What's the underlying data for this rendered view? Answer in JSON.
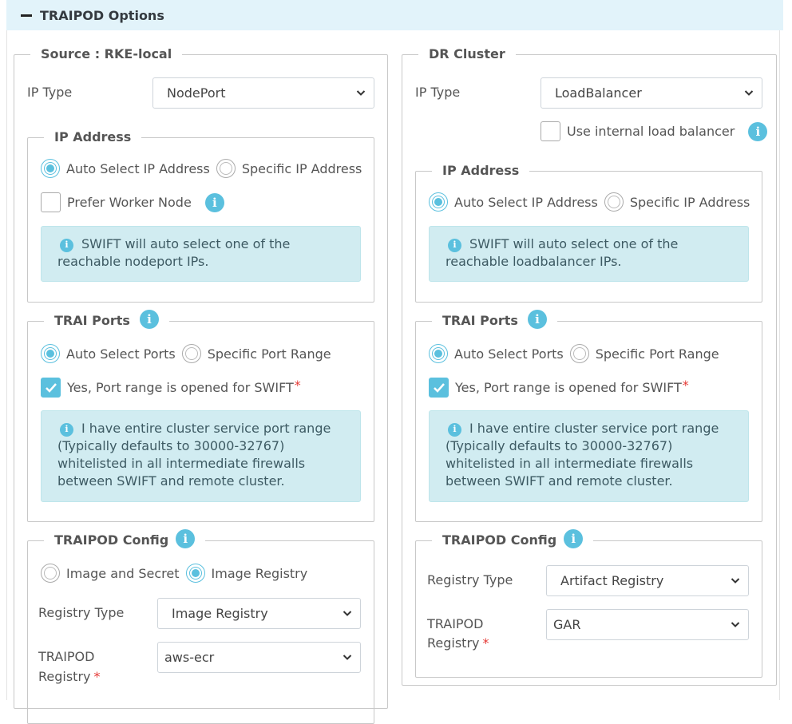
{
  "header": {
    "title": "TRAIPOD Options"
  },
  "source": {
    "legend": "Source : RKE-local",
    "ip_type_label": "IP Type",
    "ip_type_value": "NodePort",
    "ip_address": {
      "legend": "IP Address",
      "radio_auto": "Auto Select IP Address",
      "radio_specific": "Specific IP Address",
      "selected": "auto",
      "prefer_worker_label": "Prefer Worker Node",
      "prefer_worker_checked": false,
      "alert": "SWIFT will auto select one of the reachable nodeport IPs."
    },
    "trai_ports": {
      "legend": "TRAI Ports",
      "radio_auto": "Auto Select Ports",
      "radio_specific": "Specific Port Range",
      "selected": "auto",
      "confirm_label": "Yes, Port range is opened for SWIFT",
      "required": "*",
      "confirm_checked": true,
      "alert": "I have entire cluster service port range (Typically defaults to 30000-32767) whitelisted in all intermediate firewalls between SWIFT and remote cluster."
    },
    "traipod_config": {
      "legend": "TRAIPOD Config",
      "radio_image_secret": "Image and Secret",
      "radio_image_registry": "Image Registry",
      "selected": "image_registry",
      "registry_type_label": "Registry Type",
      "registry_type_value": "Image Registry",
      "registry_label_1": "TRAIPOD",
      "registry_label_2": "Registry",
      "required": "*",
      "registry_value": "aws-ecr"
    }
  },
  "dr": {
    "legend": "DR Cluster",
    "ip_type_label": "IP Type",
    "ip_type_value": "LoadBalancer",
    "internal_lb_label": "Use internal load balancer",
    "internal_lb_checked": false,
    "ip_address": {
      "legend": "IP Address",
      "radio_auto": "Auto Select IP Address",
      "radio_specific": "Specific IP Address",
      "selected": "auto",
      "alert": "SWIFT will auto select one of the reachable loadbalancer IPs."
    },
    "trai_ports": {
      "legend": "TRAI Ports",
      "radio_auto": "Auto Select Ports",
      "radio_specific": "Specific Port Range",
      "selected": "auto",
      "confirm_label": "Yes, Port range is opened for SWIFT",
      "required": "*",
      "confirm_checked": true,
      "alert": "I have entire cluster service port range (Typically defaults to 30000-32767) whitelisted in all intermediate firewalls between SWIFT and remote cluster."
    },
    "traipod_config": {
      "legend": "TRAIPOD Config",
      "registry_type_label": "Registry Type",
      "registry_type_value": "Artifact Registry",
      "registry_label_1": "TRAIPOD",
      "registry_label_2": "Registry",
      "required": "*",
      "registry_value": "GAR"
    }
  },
  "icons": {
    "info": "info-icon",
    "chevron": "chevron-down-icon",
    "collapse": "minus-icon",
    "check": "check-icon"
  },
  "colors": {
    "accent": "#5bc0de",
    "alert_bg": "#d1ecf1",
    "header_bg": "#e2f3fa",
    "required": "#e53935"
  }
}
